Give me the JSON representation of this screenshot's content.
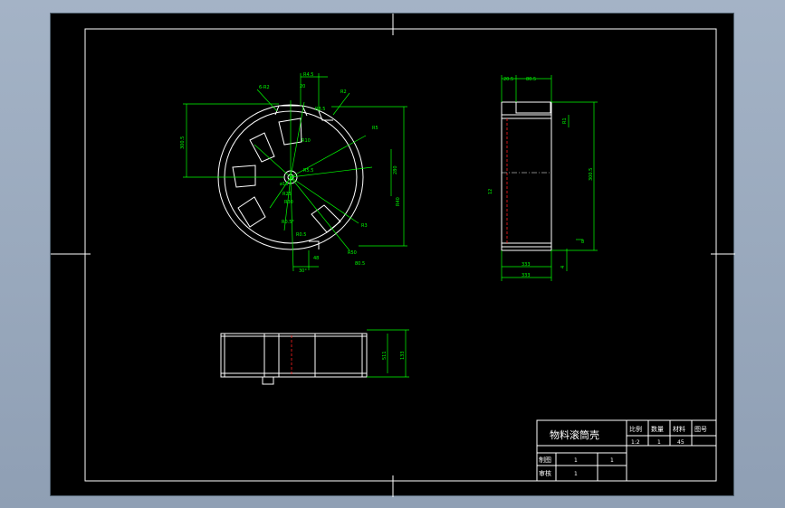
{
  "title_block": {
    "part_name": "物料滚筒壳",
    "headers": [
      "比例",
      "数量",
      "材料",
      "图号"
    ],
    "values": [
      "1:2",
      "1",
      "45",
      ""
    ],
    "rows": [
      {
        "label": "制图",
        "v1": "1",
        "v2": "1"
      },
      {
        "label": "审核",
        "v1": "1",
        "v2": ""
      }
    ]
  },
  "dimensions": {
    "front": [
      "R4.5",
      "20",
      "R2",
      "6-R2",
      "R8.5",
      "R5",
      "R10",
      "280",
      "300.5",
      "R40",
      "R5.5",
      "R25",
      "R30",
      "R3",
      "R0.5°",
      "R0.5",
      "30°",
      "48",
      "R50",
      "ø10"
    ],
    "side": [
      "20.5",
      "80.5",
      "R1",
      "80.5",
      "300.5",
      "4",
      "8",
      "333",
      "333",
      "12"
    ],
    "bottom": [
      "511",
      "133"
    ]
  },
  "colors": {
    "outline": "#ffffff",
    "dimension": "#00ff00",
    "centerline": "#ff2020",
    "background": "#000000"
  }
}
